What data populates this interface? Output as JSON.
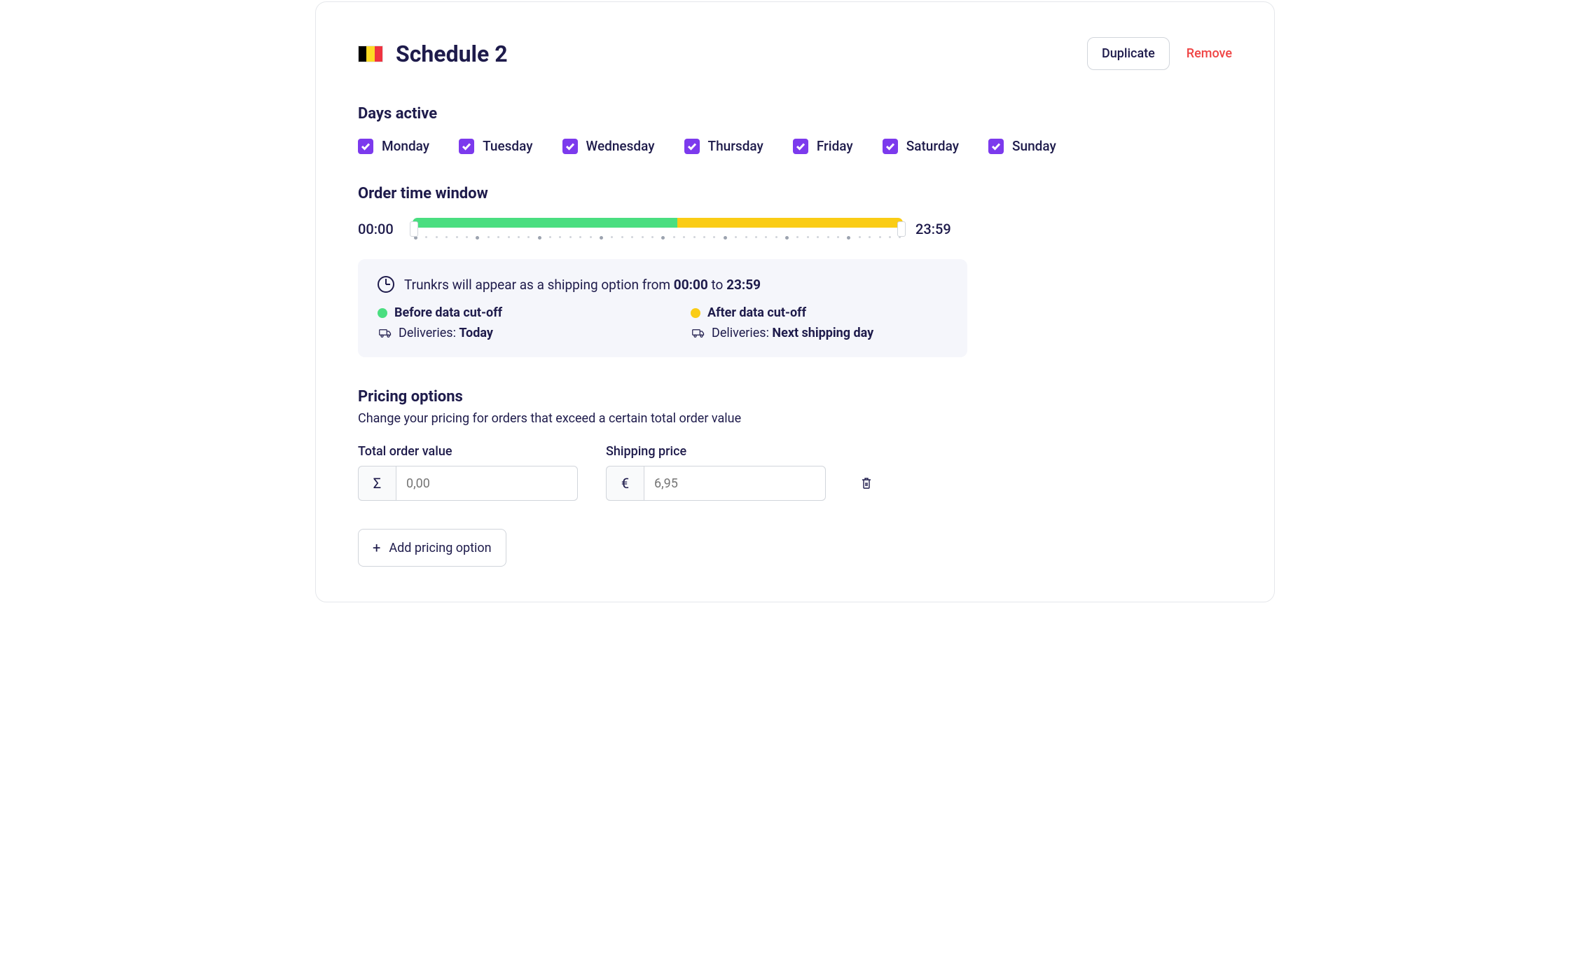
{
  "header": {
    "title": "Schedule 2",
    "duplicate": "Duplicate",
    "remove": "Remove",
    "flag_country": "Belgium"
  },
  "sections": {
    "days_active": "Days active",
    "order_time_window": "Order time window",
    "pricing_options": "Pricing options",
    "pricing_sub": "Change your pricing for orders that exceed a certain total order value"
  },
  "days": [
    {
      "label": "Monday",
      "checked": true
    },
    {
      "label": "Tuesday",
      "checked": true
    },
    {
      "label": "Wednesday",
      "checked": true
    },
    {
      "label": "Thursday",
      "checked": true
    },
    {
      "label": "Friday",
      "checked": true
    },
    {
      "label": "Saturday",
      "checked": true
    },
    {
      "label": "Sunday",
      "checked": true
    }
  ],
  "time_window": {
    "from": "00:00",
    "to": "23:59",
    "green_pct": 54,
    "yellow_pct": 46
  },
  "info": {
    "text_prefix": "Trunkrs will appear as a shipping option from ",
    "text_mid": " to ",
    "before_title": "Before data cut-off",
    "after_title": "After data cut-off",
    "deliveries_label": "Deliveries: ",
    "before_value": "Today",
    "after_value": "Next shipping day"
  },
  "pricing": {
    "total_label": "Total order value",
    "shipping_label": "Shipping price",
    "total_placeholder": "0,00",
    "shipping_placeholder": "6,95",
    "sigma": "Σ",
    "euro": "€",
    "add_label": "Add pricing option"
  }
}
